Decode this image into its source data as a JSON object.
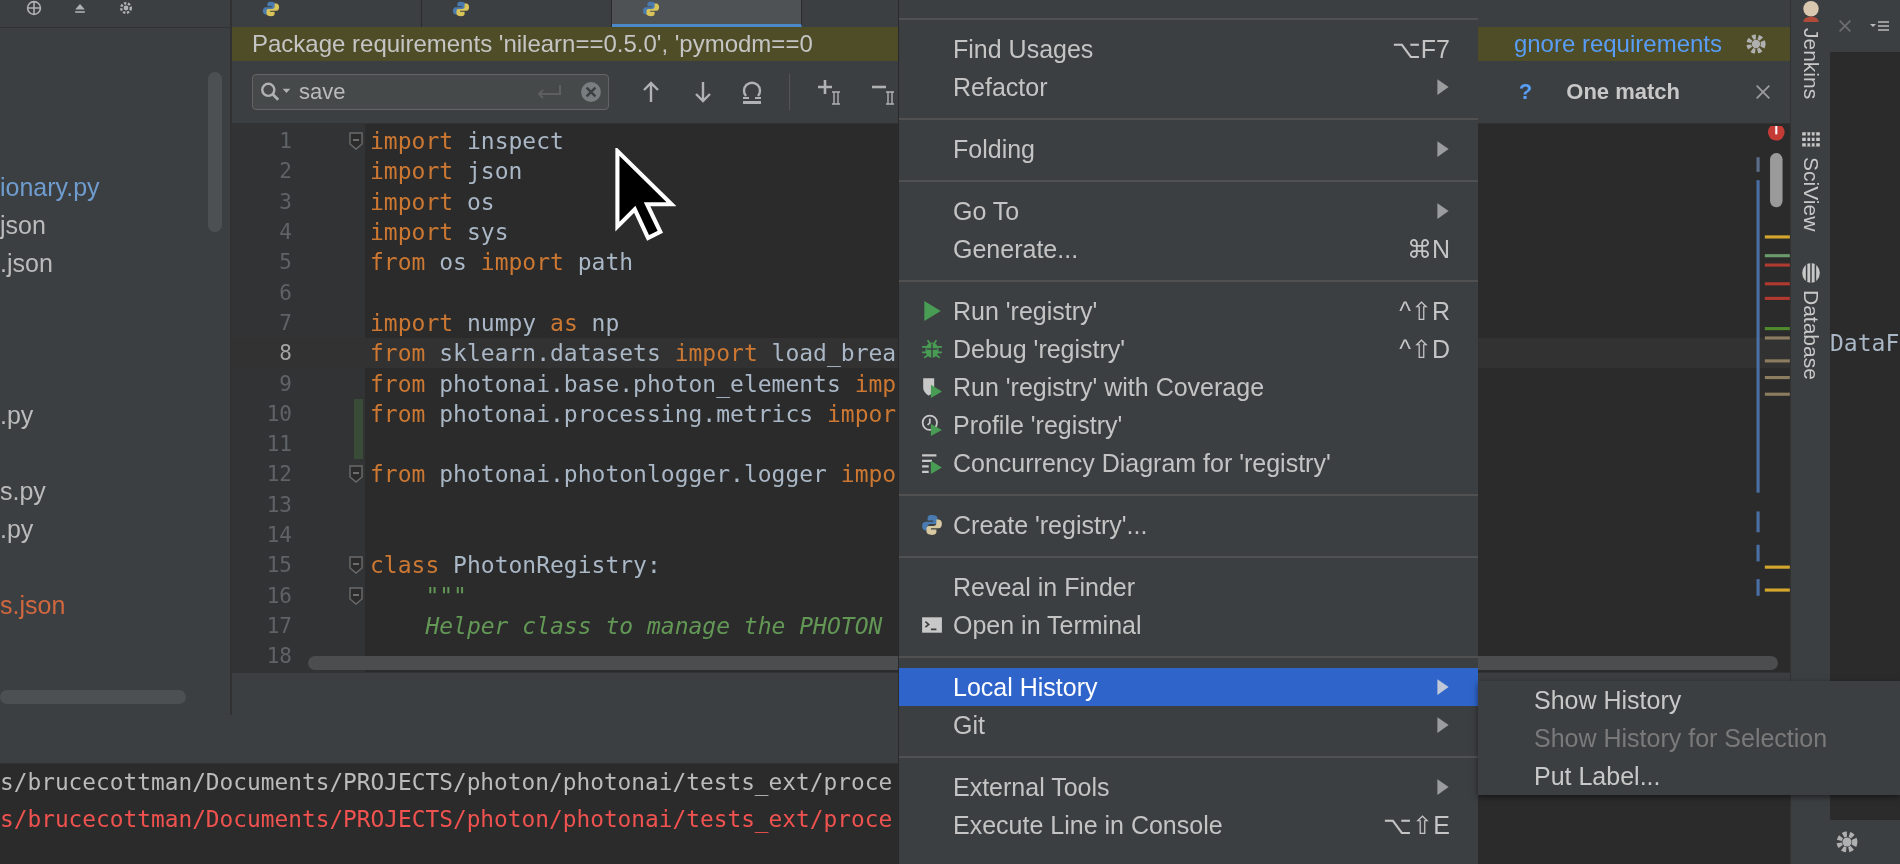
{
  "toolbar_icons": [
    {
      "kind": "target"
    },
    {
      "kind": "collapse"
    },
    {
      "kind": "gear"
    }
  ],
  "editor_tabs": [
    {
      "selected": false
    },
    {
      "selected": false
    },
    {
      "selected": true
    }
  ],
  "project_files": [
    {
      "kind": "file",
      "name": "ionary.py",
      "color": "#6f9ccf"
    },
    {
      "kind": "file",
      "name": "json",
      "color": "#bbbbbb"
    },
    {
      "kind": "file",
      "name": ".json",
      "color": "#bbbbbb"
    },
    {
      "kind": "blank"
    },
    {
      "kind": "blank"
    },
    {
      "kind": "blank"
    },
    {
      "kind": "file",
      "name": ".py",
      "color": "#bbbbbb"
    },
    {
      "kind": "blank"
    },
    {
      "kind": "file",
      "name": "s.py",
      "color": "#bbbbbb"
    },
    {
      "kind": "file",
      "name": ".py",
      "color": "#bbbbbb"
    },
    {
      "kind": "blank"
    },
    {
      "kind": "file",
      "name": "s.json",
      "color": "#d0673f"
    }
  ],
  "notification": {
    "message": "Package requirements 'nilearn==0.5.0', 'pymodm==0",
    "link": "gnore requirements"
  },
  "search": {
    "value": "save",
    "help": "?",
    "result": "One match"
  },
  "code_lines": [
    {
      "number": "1",
      "current": false,
      "changed": false,
      "fold": true,
      "tokens": [
        {
          "kind": "keyword",
          "text": "import"
        },
        {
          "kind": "name",
          "text": " inspect"
        }
      ]
    },
    {
      "number": "2",
      "current": false,
      "changed": false,
      "fold": false,
      "tokens": [
        {
          "kind": "keyword",
          "text": "import"
        },
        {
          "kind": "name",
          "text": " json"
        }
      ]
    },
    {
      "number": "3",
      "current": false,
      "changed": false,
      "fold": false,
      "tokens": [
        {
          "kind": "keyword",
          "text": "import"
        },
        {
          "kind": "name",
          "text": " os"
        }
      ]
    },
    {
      "number": "4",
      "current": false,
      "changed": false,
      "fold": false,
      "tokens": [
        {
          "kind": "keyword",
          "text": "import"
        },
        {
          "kind": "name",
          "text": " sys"
        }
      ]
    },
    {
      "number": "5",
      "current": false,
      "changed": false,
      "fold": false,
      "tokens": [
        {
          "kind": "keyword",
          "text": "from"
        },
        {
          "kind": "name",
          "text": " os "
        },
        {
          "kind": "keyword",
          "text": "import"
        },
        {
          "kind": "name",
          "text": " path"
        }
      ]
    },
    {
      "number": "6",
      "current": false,
      "changed": false,
      "fold": false
    },
    {
      "number": "7",
      "current": false,
      "changed": false,
      "fold": false,
      "tokens": [
        {
          "kind": "keyword",
          "text": "import"
        },
        {
          "kind": "name",
          "text": " numpy "
        },
        {
          "kind": "keyword",
          "text": "as"
        },
        {
          "kind": "name",
          "text": " np"
        }
      ]
    },
    {
      "number": "8",
      "current": true,
      "changed": false,
      "fold": false,
      "tokens": [
        {
          "kind": "keyword",
          "text": "from"
        },
        {
          "kind": "name",
          "text": " sklearn.datasets "
        },
        {
          "kind": "keyword",
          "text": "import"
        },
        {
          "kind": "name",
          "text": " load_brea"
        }
      ]
    },
    {
      "number": "9",
      "current": false,
      "changed": false,
      "fold": false,
      "tokens": [
        {
          "kind": "keyword",
          "text": "from"
        },
        {
          "kind": "name",
          "text": " photonai.base.photon_elements "
        },
        {
          "kind": "keyword",
          "text": "imp"
        }
      ]
    },
    {
      "number": "10",
      "current": false,
      "changed": true,
      "fold": false,
      "tokens": [
        {
          "kind": "keyword",
          "text": "from"
        },
        {
          "kind": "name",
          "text": " photonai.processing.metrics "
        },
        {
          "kind": "keyword",
          "text": "impor"
        }
      ]
    },
    {
      "number": "11",
      "current": false,
      "changed": true,
      "fold": false
    },
    {
      "number": "12",
      "current": false,
      "changed": false,
      "fold": true,
      "tokens": [
        {
          "kind": "keyword",
          "text": "from"
        },
        {
          "kind": "name",
          "text": " photonai.photonlogger.logger "
        },
        {
          "kind": "keyword",
          "text": "impo"
        }
      ]
    },
    {
      "number": "13",
      "current": false,
      "changed": false,
      "fold": false
    },
    {
      "number": "14",
      "current": false,
      "changed": false,
      "fold": false
    },
    {
      "number": "15",
      "current": false,
      "changed": false,
      "fold": true,
      "tokens": [
        {
          "kind": "keyword",
          "text": "class"
        },
        {
          "kind": "name",
          "text": " PhotonRegistry:"
        }
      ]
    },
    {
      "number": "16",
      "current": false,
      "changed": false,
      "fold": true,
      "tokens": [
        {
          "kind": "docstring",
          "text": "    \"\"\""
        }
      ]
    },
    {
      "number": "17",
      "current": false,
      "changed": false,
      "fold": false,
      "tokens": [
        {
          "kind": "docstring",
          "text": "    Helper class to manage the PHOTON"
        }
      ]
    },
    {
      "number": "18",
      "current": false,
      "changed": false,
      "fold": false
    }
  ],
  "tool_windows": [
    {
      "kind": "jenkins",
      "label": "Jenkins"
    },
    {
      "kind": "sciview",
      "label": "SciView"
    },
    {
      "kind": "database",
      "label": "Database"
    }
  ],
  "side_editor": {
    "text": "DataF"
  },
  "console_lines": [
    {
      "kind": "stdout",
      "text": "s/brucecottman/Documents/PROJECTS/photon/photonai/tests_ext/proce"
    },
    {
      "kind": "stderr",
      "text": "s/brucecottman/Documents/PROJECTS/photon/photonai/tests_ext/proce"
    }
  ],
  "context_menu": {
    "groups": [
      [
        {
          "label": "Find Usages",
          "shortcut": "⌥F7",
          "has_submenu": false,
          "selected": false
        },
        {
          "label": "Refactor",
          "has_submenu": true,
          "selected": false
        }
      ],
      [
        {
          "label": "Folding",
          "has_submenu": true,
          "selected": false
        }
      ],
      [
        {
          "label": "Go To",
          "has_submenu": true,
          "selected": false
        },
        {
          "label": "Generate...",
          "shortcut": "⌘N",
          "has_submenu": false,
          "selected": false
        }
      ],
      [
        {
          "label": "Run 'registry'",
          "shortcut": "^⇧R",
          "kind": "run",
          "has_submenu": false,
          "selected": false
        },
        {
          "label": "Debug 'registry'",
          "shortcut": "^⇧D",
          "kind": "debug",
          "has_submenu": false,
          "selected": false
        },
        {
          "label": "Run 'registry' with Coverage",
          "kind": "coverage",
          "has_submenu": false,
          "selected": false
        },
        {
          "label": "Profile 'registry'",
          "kind": "profile",
          "has_submenu": false,
          "selected": false
        },
        {
          "label": "Concurrency Diagram for 'registry'",
          "kind": "concurrency",
          "has_submenu": false,
          "selected": false
        }
      ],
      [
        {
          "label": "Create 'registry'...",
          "kind": "python",
          "has_submenu": false,
          "selected": false
        }
      ],
      [
        {
          "label": "Reveal in Finder",
          "has_submenu": false,
          "selected": false
        },
        {
          "label": "Open in Terminal",
          "kind": "terminal",
          "has_submenu": false,
          "selected": false
        }
      ],
      [
        {
          "label": "Local History",
          "has_submenu": true,
          "selected": true
        },
        {
          "label": "Git",
          "has_submenu": true,
          "selected": false
        }
      ],
      [
        {
          "label": "External Tools",
          "has_submenu": true,
          "selected": false
        },
        {
          "label": "Execute Line in Console",
          "shortcut": "⌥⇧E",
          "has_submenu": false,
          "selected": false
        }
      ]
    ]
  },
  "submenu": {
    "items": [
      {
        "label": "Show History",
        "disabled": false
      },
      {
        "label": "Show History for Selection",
        "disabled": true
      },
      {
        "label": "Put Label...",
        "disabled": false
      }
    ]
  }
}
